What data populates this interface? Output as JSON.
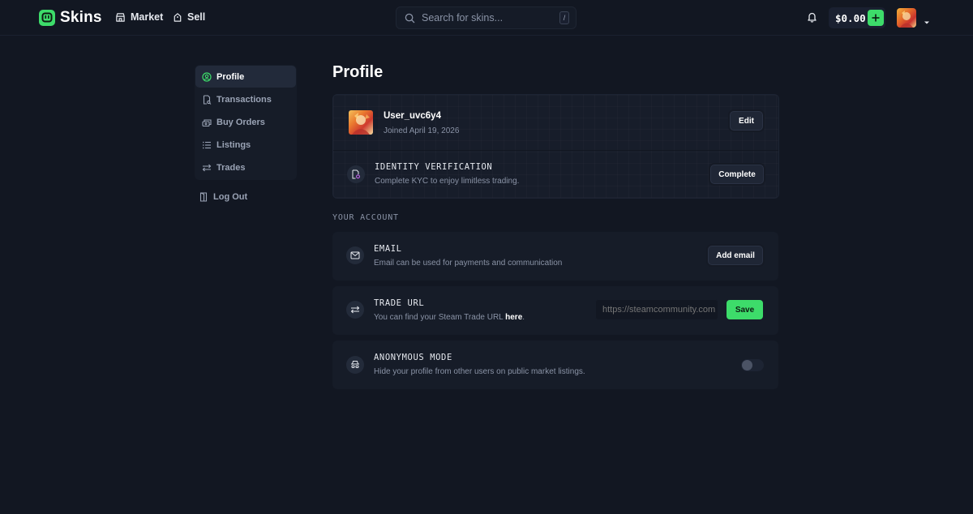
{
  "header": {
    "logo_text": "Skins",
    "nav": [
      {
        "label": "Market",
        "icon": "store-icon"
      },
      {
        "label": "Sell",
        "icon": "tag-icon"
      }
    ],
    "search": {
      "placeholder": "Search for skins...",
      "shortcut": "/"
    },
    "balance": "$0.00"
  },
  "sidebar": {
    "items": [
      {
        "label": "Profile",
        "icon": "user-circle-icon",
        "active": true
      },
      {
        "label": "Transactions",
        "icon": "receipt-icon",
        "active": false
      },
      {
        "label": "Buy Orders",
        "icon": "cash-icon",
        "active": false
      },
      {
        "label": "Listings",
        "icon": "list-icon",
        "active": false
      },
      {
        "label": "Trades",
        "icon": "swap-icon",
        "active": false
      }
    ],
    "logout": "Log Out"
  },
  "main": {
    "title": "Profile",
    "profile": {
      "username": "User_uvc6y4",
      "joined": "Joined April 19, 2026",
      "edit_label": "Edit"
    },
    "identity": {
      "title": "IDENTITY VERIFICATION",
      "desc": "Complete KYC to enjoy limitless trading.",
      "button": "Complete"
    },
    "section_label": "YOUR ACCOUNT",
    "email": {
      "title": "EMAIL",
      "desc": "Email can be used for payments and communication",
      "button": "Add email"
    },
    "trade_url": {
      "title": "TRADE URL",
      "desc_prefix": "You can find your Steam Trade URL ",
      "desc_link": "here",
      "desc_suffix": ".",
      "placeholder": "https://steamcommunity.com",
      "button": "Save"
    },
    "anonymous": {
      "title": "ANONYMOUS MODE",
      "desc": "Hide your profile from other users on public market listings.",
      "enabled": false
    }
  },
  "colors": {
    "background": "#121722",
    "accent": "#3ddc6a",
    "card": "#161c28"
  }
}
